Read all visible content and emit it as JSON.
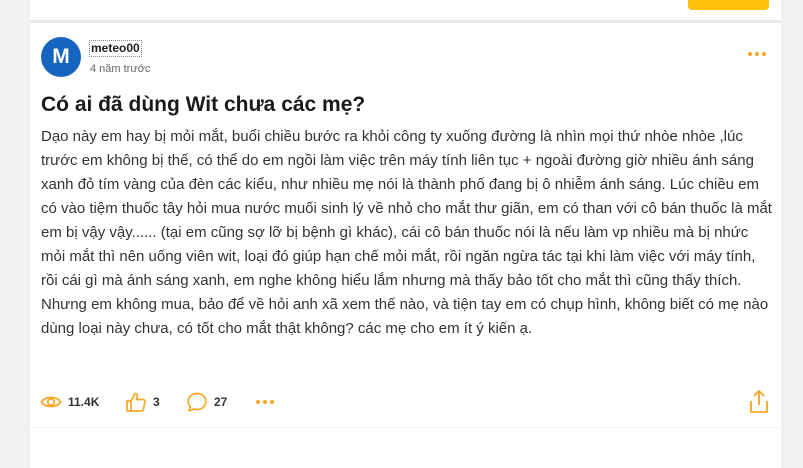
{
  "post": {
    "avatar_initial": "M",
    "author": "meteo00",
    "time_ago": "4 năm trước",
    "title": "Có ai đã dùng Wit chưa các mẹ?",
    "body": "Dạo này em hay bị mỏi mắt, buổi chiều bước ra khỏi công ty xuống đường là nhìn mọi thứ nhòe nhòe ,lúc trước em không bị thế, có thể do em ngồi làm việc trên máy tính liên tục + ngoài đường giờ nhiều ánh sáng xanh đỏ tím vàng của đèn các kiểu, như nhiều mẹ nói là thành phố đang bị ô nhiễm ánh sáng. Lúc chiều em có vào tiệm thuốc tây hỏi mua nước muối sinh lý về nhỏ cho mắt thư giãn, em có than với cô bán thuốc là mắt em bị vậy vậy...... (tại em cũng sợ lỡ bị bệnh gì khác), cái cô bán thuốc nói là nếu làm vp nhiều mà bị nhức mỏi mắt thì nên uống viên wit, loại đó giúp hạn chế mỏi mắt, rồi ngăn ngừa tác tại khi làm việc với máy tính, rồi cái gì mà ánh sáng xanh, em nghe không hiểu lắm nhưng mà thấy bảo tốt cho mắt thì cũng thấy thích. Nhưng em không mua, bảo để về hỏi anh xã xem thế nào, và tiện tay em có chụp hình, không biết có mẹ nào dùng loại này chưa, có tốt cho mắt thật không? các mẹ cho em ít ý kiến ạ."
  },
  "stats": {
    "views": "11.4K",
    "likes": "3",
    "comments": "27"
  },
  "icons": {
    "views": "eye-icon",
    "likes": "thumbs-up-icon",
    "comments": "comment-icon",
    "more": "more-horizontal-icon",
    "share": "share-icon"
  },
  "colors": {
    "avatar_bg": "#1565c0",
    "accent": "#f5a623",
    "primary_button": "#ffc107"
  }
}
